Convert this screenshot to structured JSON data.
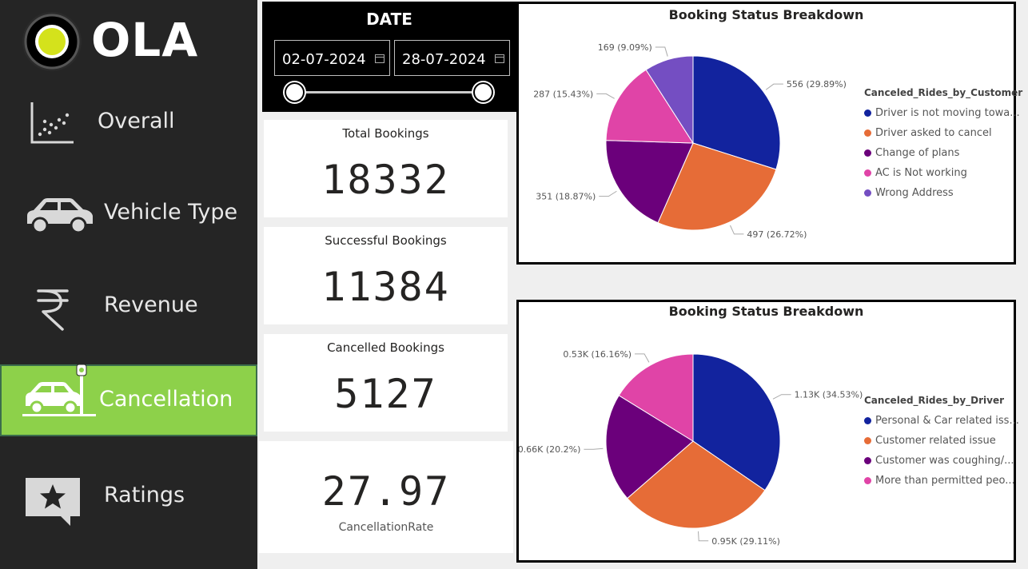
{
  "brand": {
    "name": "OLA"
  },
  "sidebar": {
    "items": [
      {
        "label": "Overall",
        "icon": "scatter-chart-icon",
        "active": false
      },
      {
        "label": "Vehicle Type",
        "icon": "car-icon",
        "active": false
      },
      {
        "label": "Revenue",
        "icon": "rupee-icon",
        "active": false
      },
      {
        "label": "Cancellation",
        "icon": "car-crash-icon",
        "active": true
      },
      {
        "label": "Ratings",
        "icon": "star-message-icon",
        "active": false
      }
    ],
    "active_color": "#8dd14a"
  },
  "date_filter": {
    "title": "DATE",
    "start": "02-07-2024",
    "end": "28-07-2024"
  },
  "kpis": {
    "total": {
      "label": "Total Bookings",
      "value": "18332"
    },
    "successful": {
      "label": "Successful Bookings",
      "value": "11384"
    },
    "cancelled": {
      "label": "Cancelled Bookings",
      "value": "5127"
    },
    "rate": {
      "label": "CancellationRate",
      "value": "27.97"
    }
  },
  "chart_data": [
    {
      "type": "pie",
      "title": "Booking Status Breakdown",
      "legend_title": "Canceled_Rides_by_Customer",
      "legend_position": "right",
      "slices": [
        {
          "name": "Driver is not moving towa...",
          "value": 556,
          "label": "556 (29.89%)",
          "color": "#12239e"
        },
        {
          "name": "Driver asked to cancel",
          "value": 497,
          "label": "497 (26.72%)",
          "color": "#e66c37"
        },
        {
          "name": "Change of plans",
          "value": 351,
          "label": "351 (18.87%)",
          "color": "#6b007b"
        },
        {
          "name": "AC is Not working",
          "value": 287,
          "label": "287 (15.43%)",
          "color": "#e044a7"
        },
        {
          "name": "Wrong Address",
          "value": 169,
          "label": "169 (9.09%)",
          "color": "#744ec2"
        }
      ]
    },
    {
      "type": "pie",
      "title": "Booking Status Breakdown",
      "legend_title": "Canceled_Rides_by_Driver",
      "legend_position": "right",
      "slices": [
        {
          "name": "Personal & Car related iss...",
          "value": 1130,
          "label": "1.13K (34.53%)",
          "color": "#12239e"
        },
        {
          "name": "Customer related issue",
          "value": 950,
          "label": "0.95K (29.11%)",
          "color": "#e66c37"
        },
        {
          "name": "Customer was coughing/...",
          "value": 660,
          "label": "0.66K (20.2%)",
          "color": "#6b007b"
        },
        {
          "name": "More than permitted peo...",
          "value": 530,
          "label": "0.53K (16.16%)",
          "color": "#e044a7"
        }
      ]
    }
  ]
}
